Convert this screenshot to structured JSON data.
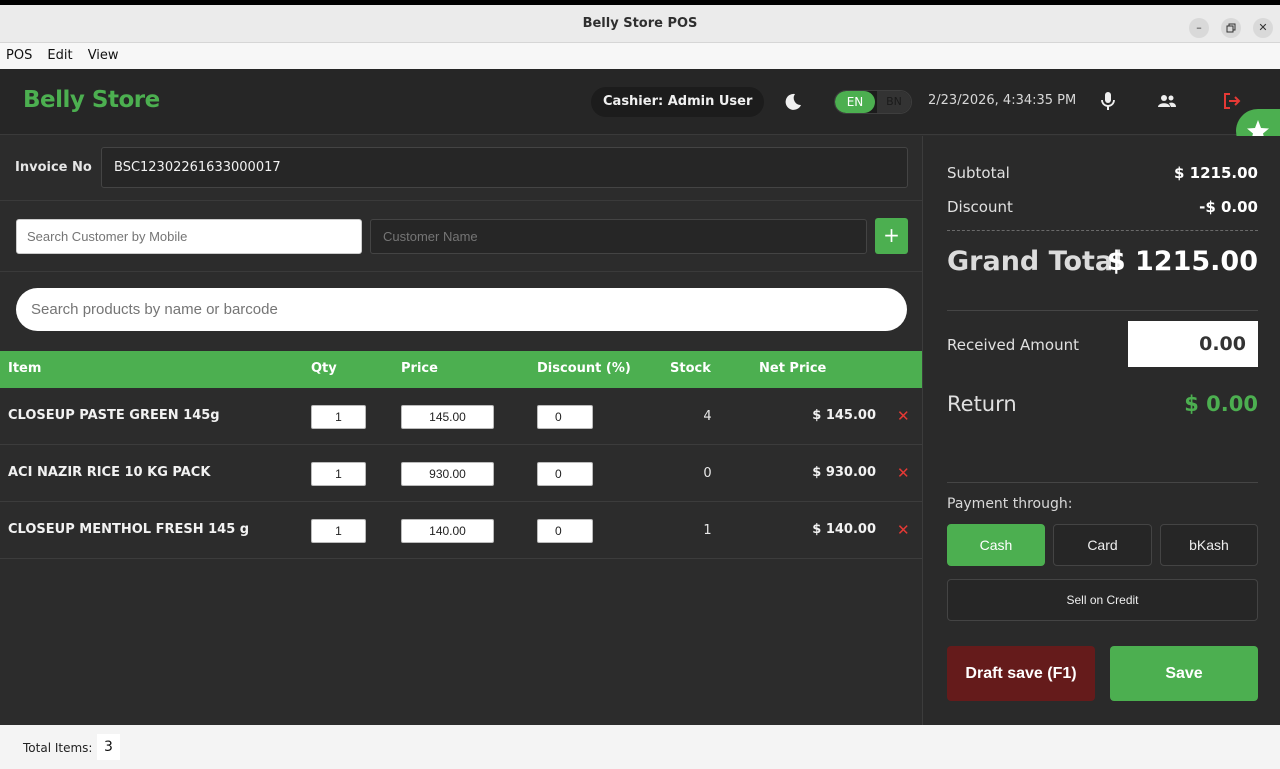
{
  "window": {
    "title": "Belly Store POS",
    "menu": [
      "POS",
      "Edit",
      "View"
    ]
  },
  "header": {
    "brand": "Belly Store",
    "cashier": "Cashier: Admin User",
    "lang_en": "EN",
    "lang_bn": "BN",
    "datetime": "2/23/2026, 4:34:35 PM"
  },
  "invoice": {
    "label": "Invoice No",
    "number": "BSC12302261633000017"
  },
  "customer": {
    "mobile_placeholder": "Search Customer by Mobile",
    "name_placeholder": "Customer Name",
    "add_label": "+"
  },
  "product_search": {
    "placeholder": "Search products by name or barcode"
  },
  "table": {
    "headers": {
      "item": "Item",
      "qty": "Qty",
      "price": "Price",
      "discount": "Discount (%)",
      "stock": "Stock",
      "net": "Net Price"
    },
    "rows": [
      {
        "name": "CLOSEUP PASTE GREEN 145g",
        "qty": "1",
        "price": "145.00",
        "discount": "0",
        "stock": "4",
        "net": "$ 145.00"
      },
      {
        "name": "ACI NAZIR RICE 10 KG PACK",
        "qty": "1",
        "price": "930.00",
        "discount": "0",
        "stock": "0",
        "net": "$ 930.00"
      },
      {
        "name": "CLOSEUP MENTHOL FRESH 145 g",
        "qty": "1",
        "price": "140.00",
        "discount": "0",
        "stock": "1",
        "net": "$ 140.00"
      }
    ],
    "delete_glyph": "✕"
  },
  "summary": {
    "subtotal_label": "Subtotal",
    "subtotal": "$ 1215.00",
    "discount_label": "Discount",
    "discount": "-$ 0.00",
    "grand_label": "Grand Total",
    "grand": "$ 1215.00",
    "received_label": "Received Amount",
    "received": "0.00",
    "return_label": "Return",
    "return": "$ 0.00"
  },
  "payment": {
    "label": "Payment through:",
    "methods": [
      "Cash",
      "Card",
      "bKash"
    ],
    "selected": "Cash",
    "credit": "Sell on Credit",
    "draft": "Draft save (F1)",
    "save": "Save"
  },
  "status": {
    "total_items_label": "Total Items:",
    "total_items": "3"
  },
  "colors": {
    "accent": "#4caf50",
    "danger": "#e53935",
    "draft": "#651b1b"
  },
  "icons": [
    "moon-icon",
    "microphone-icon",
    "users-icon",
    "logout-icon",
    "star-icon",
    "close-icon",
    "minimize-icon",
    "restore-icon"
  ]
}
